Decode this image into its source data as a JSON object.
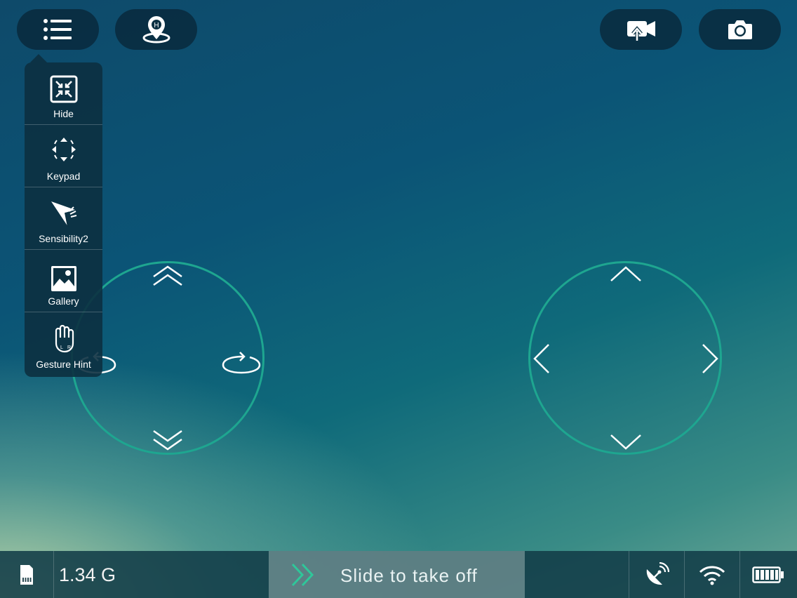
{
  "menu_button": {
    "icon": "list-icon"
  },
  "home_button": {
    "icon": "home-location-icon",
    "letter": "H"
  },
  "record_button": {
    "icon": "video-upload-icon"
  },
  "photo_button": {
    "icon": "camera-icon"
  },
  "menu": {
    "items": [
      {
        "label": "Hide",
        "icon": "collapse-icon"
      },
      {
        "label": "Keypad",
        "icon": "keypad-icon"
      },
      {
        "label": "Sensibility2",
        "icon": "sensibility-icon"
      },
      {
        "label": "Gallery",
        "icon": "gallery-icon"
      },
      {
        "label": "Gesture Hint",
        "icon": "hand-icon"
      }
    ]
  },
  "status": {
    "storage": "1.34 G",
    "slider_label": "Slide to take off"
  },
  "colors": {
    "accent": "#1ea690",
    "panel": "#0c3040"
  }
}
